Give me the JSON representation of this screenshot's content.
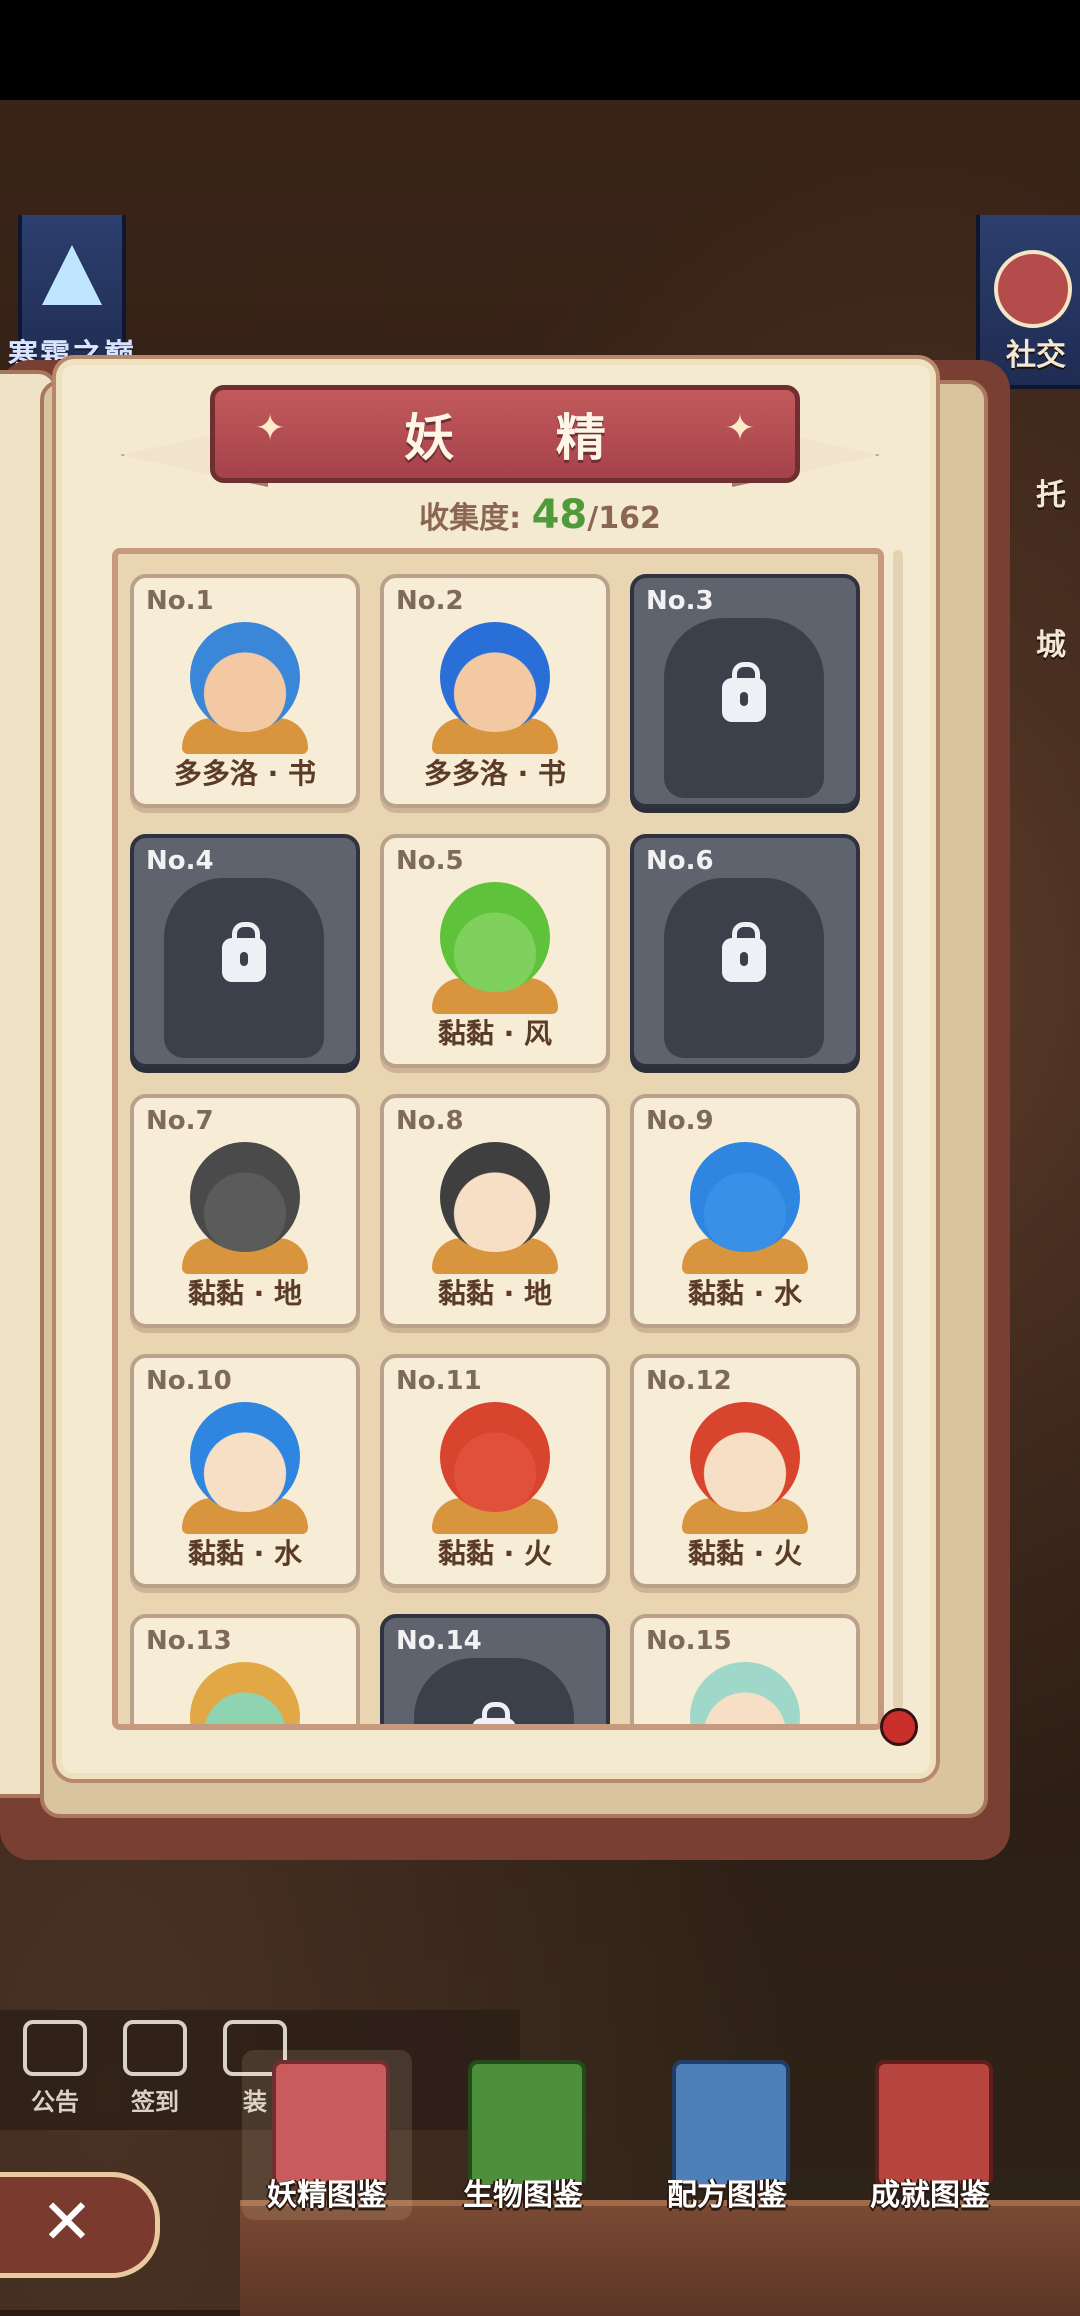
{
  "background": {
    "left_banner_label": "寒霜之巅",
    "right_labels": [
      "社交",
      "托",
      "城"
    ]
  },
  "book": {
    "title": "妖 精",
    "collection_label": "收集度:",
    "collected": "48",
    "total": "/162"
  },
  "cards": [
    {
      "no": "No.1",
      "name": "多多洛 · 书",
      "locked": false,
      "hair": "#3a86d9",
      "skin": "#f3c9a3"
    },
    {
      "no": "No.2",
      "name": "多多洛 · 书",
      "locked": false,
      "hair": "#2a6fd8",
      "skin": "#f3c9a3"
    },
    {
      "no": "No.3",
      "name": "",
      "locked": true
    },
    {
      "no": "No.4",
      "name": "",
      "locked": true
    },
    {
      "no": "No.5",
      "name": "黏黏 · 风",
      "locked": false,
      "hair": "#5ec23a",
      "skin": "#7fd05c"
    },
    {
      "no": "No.6",
      "name": "",
      "locked": true
    },
    {
      "no": "No.7",
      "name": "黏黏 · 地",
      "locked": false,
      "hair": "#4a4a4a",
      "skin": "#5b5b5b"
    },
    {
      "no": "No.8",
      "name": "黏黏 · 地",
      "locked": false,
      "hair": "#3f3f3f",
      "skin": "#f6dfc5"
    },
    {
      "no": "No.9",
      "name": "黏黏 · 水",
      "locked": false,
      "hair": "#2f86e0",
      "skin": "#3a8fe6"
    },
    {
      "no": "No.10",
      "name": "黏黏 · 水",
      "locked": false,
      "hair": "#2f86e0",
      "skin": "#f6dfc5"
    },
    {
      "no": "No.11",
      "name": "黏黏 · 火",
      "locked": false,
      "hair": "#d9442e",
      "skin": "#e0503a"
    },
    {
      "no": "No.12",
      "name": "黏黏 · 火",
      "locked": false,
      "hair": "#d9442e",
      "skin": "#f6dfc5"
    },
    {
      "no": "No.13",
      "name": "",
      "locked": false,
      "hair": "#e2a845",
      "skin": "#8fd3b0"
    },
    {
      "no": "No.14",
      "name": "",
      "locked": true
    },
    {
      "no": "No.15",
      "name": "",
      "locked": false,
      "hair": "#9fd8c8",
      "skin": "#f6dfc5"
    }
  ],
  "toolbar": {
    "items": [
      {
        "label": "公告",
        "icon": "book-open-icon"
      },
      {
        "label": "签到",
        "icon": "calendar-check-icon"
      },
      {
        "label": "装",
        "icon": "equipment-icon"
      }
    ]
  },
  "tabs": [
    {
      "label": "妖精图鉴",
      "color": "#c85b5b",
      "icon": "fairy-book-icon",
      "active": true
    },
    {
      "label": "生物图鉴",
      "color": "#4d8f3a",
      "icon": "plant-book-icon",
      "active": false
    },
    {
      "label": "配方图鉴",
      "color": "#4f7fb8",
      "icon": "potion-book-icon",
      "active": false
    },
    {
      "label": "成就图鉴",
      "color": "#b6443f",
      "icon": "crown-book-icon",
      "active": false
    }
  ],
  "close_label": "✕"
}
